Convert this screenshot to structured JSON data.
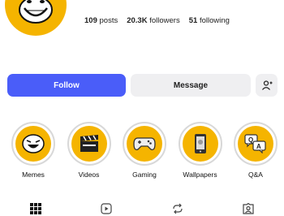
{
  "profile": {
    "stats": [
      {
        "value": "109",
        "label": "posts"
      },
      {
        "value": "20.3K",
        "label": "followers"
      },
      {
        "value": "51",
        "label": "following"
      }
    ]
  },
  "actions": {
    "follow_label": "Follow",
    "message_label": "Message",
    "add_icon": "add-person-icon"
  },
  "highlights": [
    {
      "label": "Memes",
      "icon": "laughing-face-icon"
    },
    {
      "label": "Videos",
      "icon": "clapperboard-icon"
    },
    {
      "label": "Gaming",
      "icon": "gamepad-icon"
    },
    {
      "label": "Wallpapers",
      "icon": "phone-icon"
    },
    {
      "label": "Q&A",
      "icon": "speech-bubbles-icon"
    }
  ],
  "tabs": [
    "grid-icon",
    "reels-icon",
    "repost-icon",
    "tagged-icon"
  ],
  "colors": {
    "accent": "#4a5df9",
    "highlight": "#f5b400",
    "button_gray": "#efeff1"
  }
}
